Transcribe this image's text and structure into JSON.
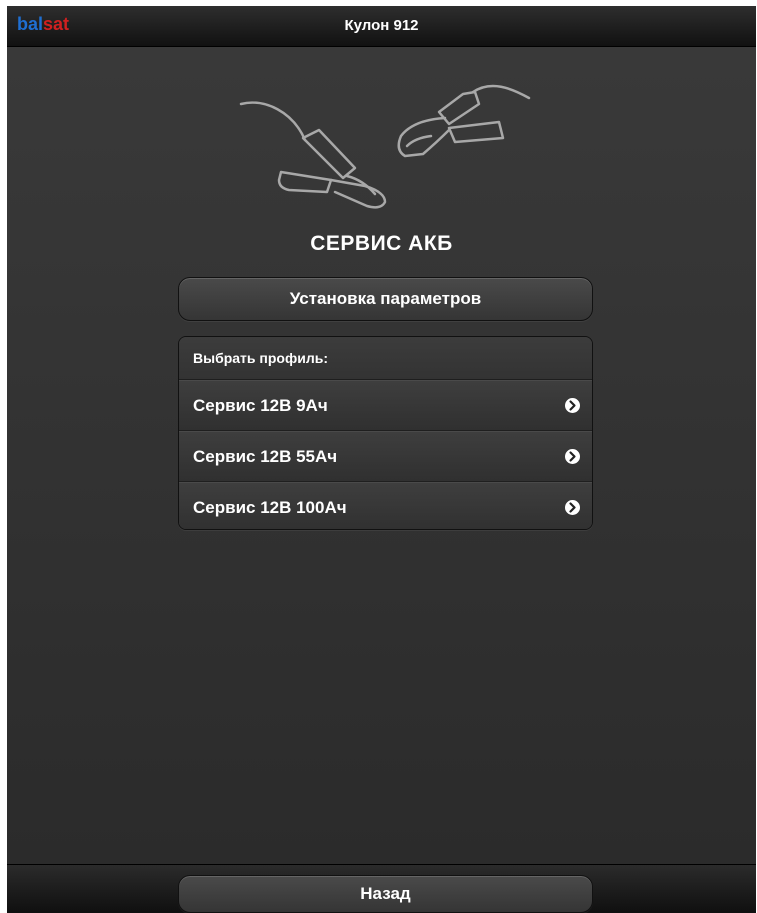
{
  "header": {
    "logo_part1": "bal",
    "logo_part2": "sat",
    "title": "Кулон 912"
  },
  "main": {
    "illustration": "battery-clamps-icon",
    "heading": "СЕРВИС АКБ",
    "setup_button": "Установка параметров",
    "profiles": {
      "label": "Выбрать профиль:",
      "items": [
        {
          "label": "Сервис 12В 9Ач"
        },
        {
          "label": "Сервис 12В 55Ач"
        },
        {
          "label": "Сервис 12В 100Ач"
        }
      ]
    }
  },
  "footer": {
    "back_button": "Назад"
  },
  "colors": {
    "logo_blue": "#1f6fd2",
    "logo_red": "#d02020",
    "background": "#333333"
  }
}
